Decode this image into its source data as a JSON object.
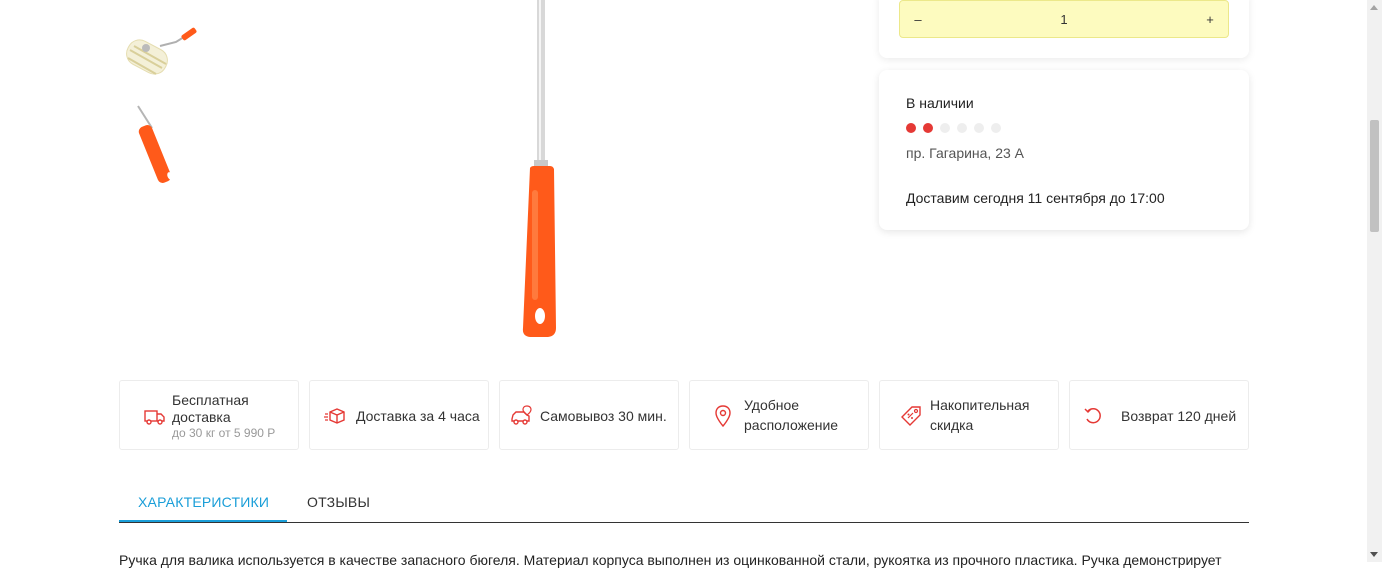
{
  "gallery": {
    "thumbnails": [
      {
        "icon": "paint-roller-thumbnail"
      },
      {
        "icon": "roller-handle-thumbnail"
      }
    ],
    "main_image": {
      "icon": "roller-handle-image"
    }
  },
  "quantity": {
    "minus_label": "–",
    "value": "1",
    "plus_label": "+"
  },
  "availability": {
    "status": "В наличии",
    "stock_level": 2,
    "stock_max": 6,
    "address": "пр. Гагарина, 23 А",
    "delivery": "Доставим сегодня 11 сентября до 17:00"
  },
  "features": [
    {
      "line1": "Бесплатная",
      "line2": "доставка",
      "sub": "до 30 кг от 5 990 Р",
      "icon": "free-delivery-truck-icon"
    },
    {
      "line1": "Доставка за 4 часа",
      "icon": "fast-box-icon"
    },
    {
      "line1": "Самовывоз 30 мин.",
      "icon": "car-pickup-icon"
    },
    {
      "line1": "Удобное",
      "line2": "расположение",
      "icon": "map-pin-icon"
    },
    {
      "line1": "Накопительная",
      "line2": "скидка",
      "icon": "discount-tag-icon"
    },
    {
      "line1": "Возврат 120 дней",
      "icon": "return-arrow-icon"
    }
  ],
  "tabs": [
    {
      "label": "ХАРАКТЕРИСТИКИ",
      "active": true
    },
    {
      "label": "ОТЗЫВЫ",
      "active": false
    }
  ],
  "description": "Ручка для валика используется в качестве запасного бюгеля. Материал корпуса выполнен из оцинкованной стали, рукоятка из прочного пластика. Ручка демонстрирует",
  "colors": {
    "accent_red": "#e53935",
    "accent_orange": "#ff5a1a",
    "tab_active": "#1a9ed8",
    "qty_bg": "#fdfbbf"
  }
}
